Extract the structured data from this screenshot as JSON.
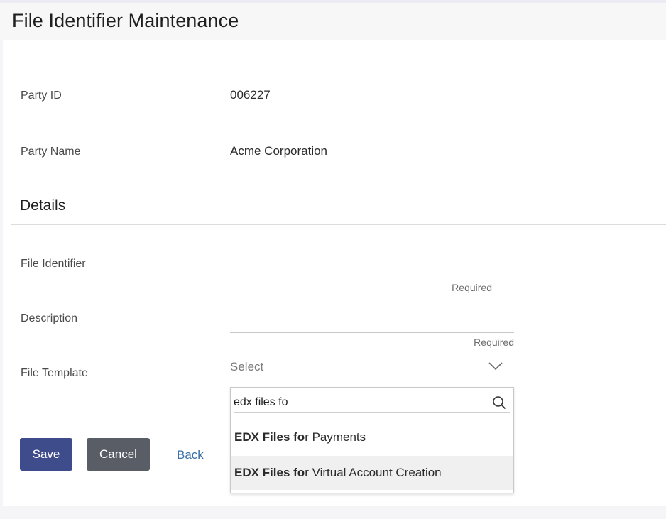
{
  "page": {
    "title": "File Identifier Maintenance"
  },
  "party": {
    "id_label": "Party ID",
    "id_value": "006227",
    "name_label": "Party Name",
    "name_value": "Acme Corporation"
  },
  "details": {
    "section_title": "Details",
    "file_identifier": {
      "label": "File Identifier",
      "value": "",
      "hint": "Required"
    },
    "description": {
      "label": "Description",
      "value": "",
      "hint": "Required"
    },
    "file_template": {
      "label": "File Template",
      "selected": "Select",
      "search_value": "edx files fo",
      "options": [
        {
          "match": "EDX Files fo",
          "rest": "r Payments",
          "highlighted": false
        },
        {
          "match": "EDX Files fo",
          "rest": "r Virtual Account Creation",
          "highlighted": true
        }
      ]
    }
  },
  "actions": {
    "save_label": "Save",
    "cancel_label": "Cancel",
    "back_label": "Back"
  },
  "colors": {
    "primary_button": "#3f4c8c",
    "secondary_button": "#595e66",
    "link": "#3a6fa8",
    "highlight_row": "#f0f0f0"
  },
  "icons": {
    "dropdown": "chevron-down-icon",
    "search": "search-icon"
  }
}
